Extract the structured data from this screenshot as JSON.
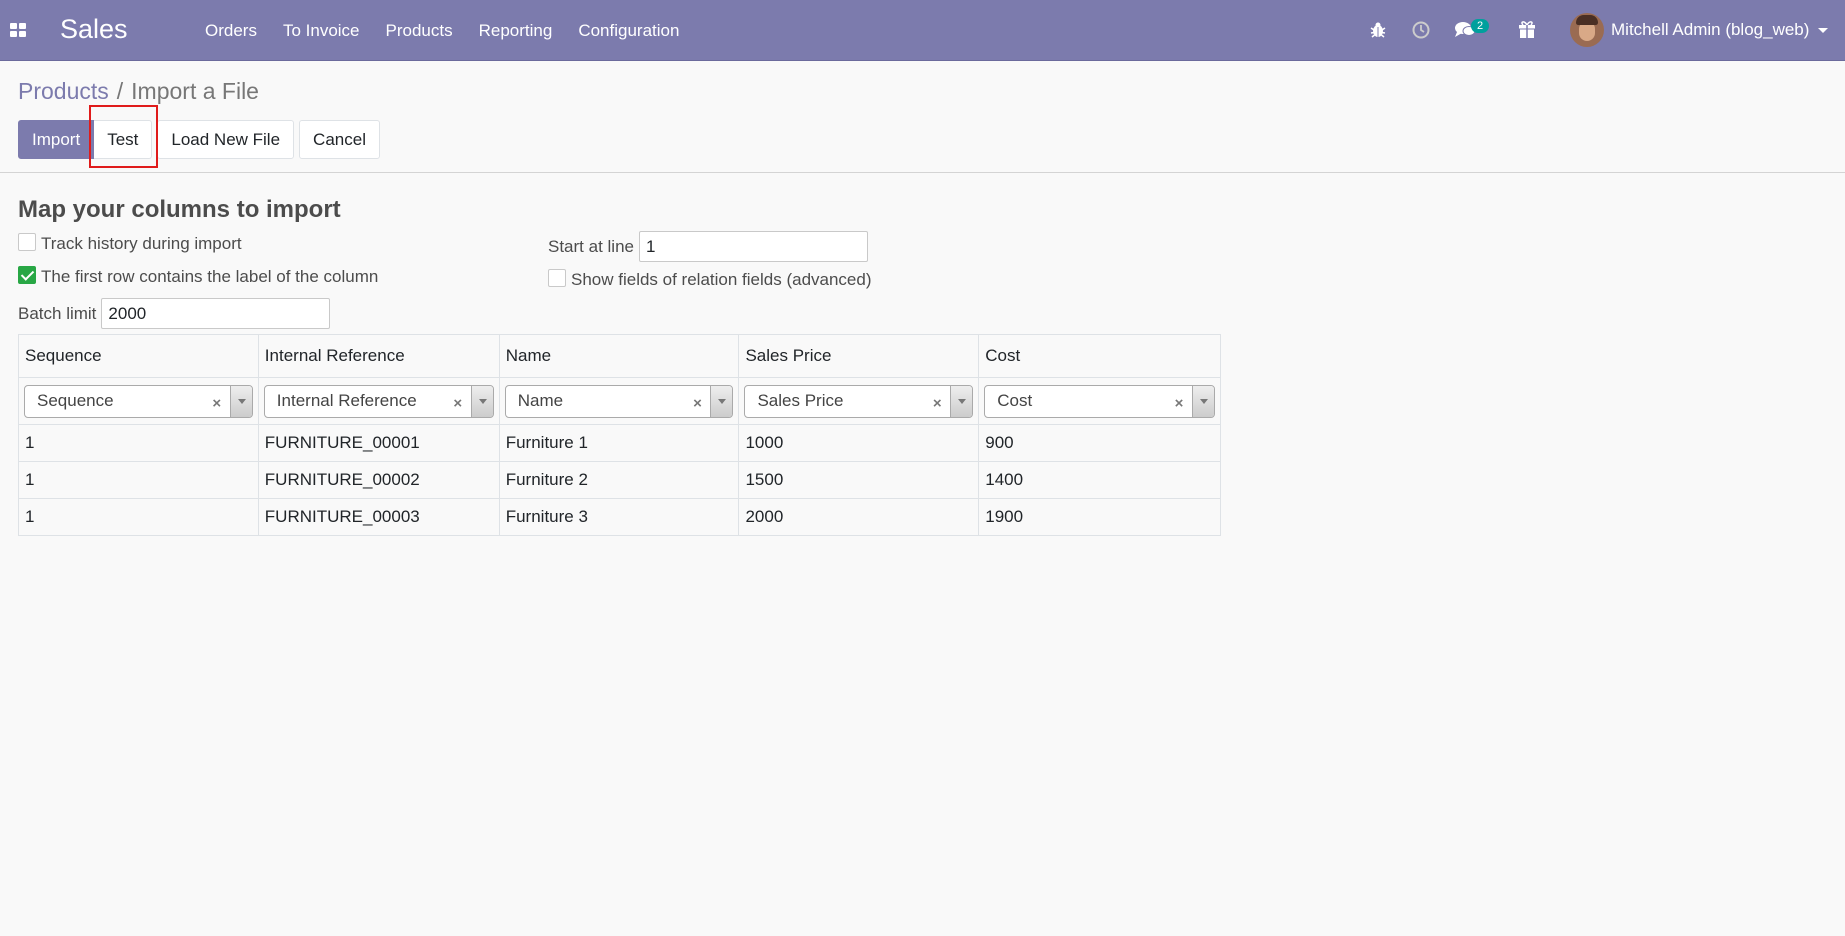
{
  "navbar": {
    "brand": "Sales",
    "menu": [
      "Orders",
      "To Invoice",
      "Products",
      "Reporting",
      "Configuration"
    ],
    "messages_badge": "2",
    "user_name": "Mitchell Admin (blog_web)",
    "icons": [
      "apps-icon",
      "bug-icon",
      "clock-icon",
      "chat-icon",
      "gift-icon"
    ]
  },
  "breadcrumb": {
    "parent": "Products",
    "separator": "/",
    "current": "Import a File"
  },
  "buttons": {
    "import": "Import",
    "test": "Test",
    "load_new_file": "Load New File",
    "cancel": "Cancel"
  },
  "section_title": "Map your columns to import",
  "options": {
    "track_history": {
      "label": "Track history during import",
      "checked": false
    },
    "first_row_header": {
      "label": "The first row contains the label of the column",
      "checked": true
    },
    "start_at_line": {
      "label": "Start at line",
      "value": "1"
    },
    "show_relation_fields": {
      "label": "Show fields of relation fields (advanced)",
      "checked": false
    },
    "batch_limit": {
      "label": "Batch limit",
      "value": "2000"
    }
  },
  "table": {
    "headers": [
      "Sequence",
      "Internal Reference",
      "Name",
      "Sales Price",
      "Cost"
    ],
    "mapping": [
      "Sequence",
      "Internal Reference",
      "Name",
      "Sales Price",
      "Cost"
    ],
    "rows": [
      [
        "1",
        "FURNITURE_00001",
        "Furniture 1",
        "1000",
        "900"
      ],
      [
        "1",
        "FURNITURE_00002",
        "Furniture 2",
        "1500",
        "1400"
      ],
      [
        "1",
        "FURNITURE_00003",
        "Furniture 3",
        "2000",
        "1900"
      ]
    ]
  },
  "colors": {
    "navbar": "#7c7bad",
    "primary_button": "#7c7bad",
    "checkbox_checked": "#28a745",
    "highlight_box": "#e01b1b",
    "badge": "#00a09d"
  }
}
